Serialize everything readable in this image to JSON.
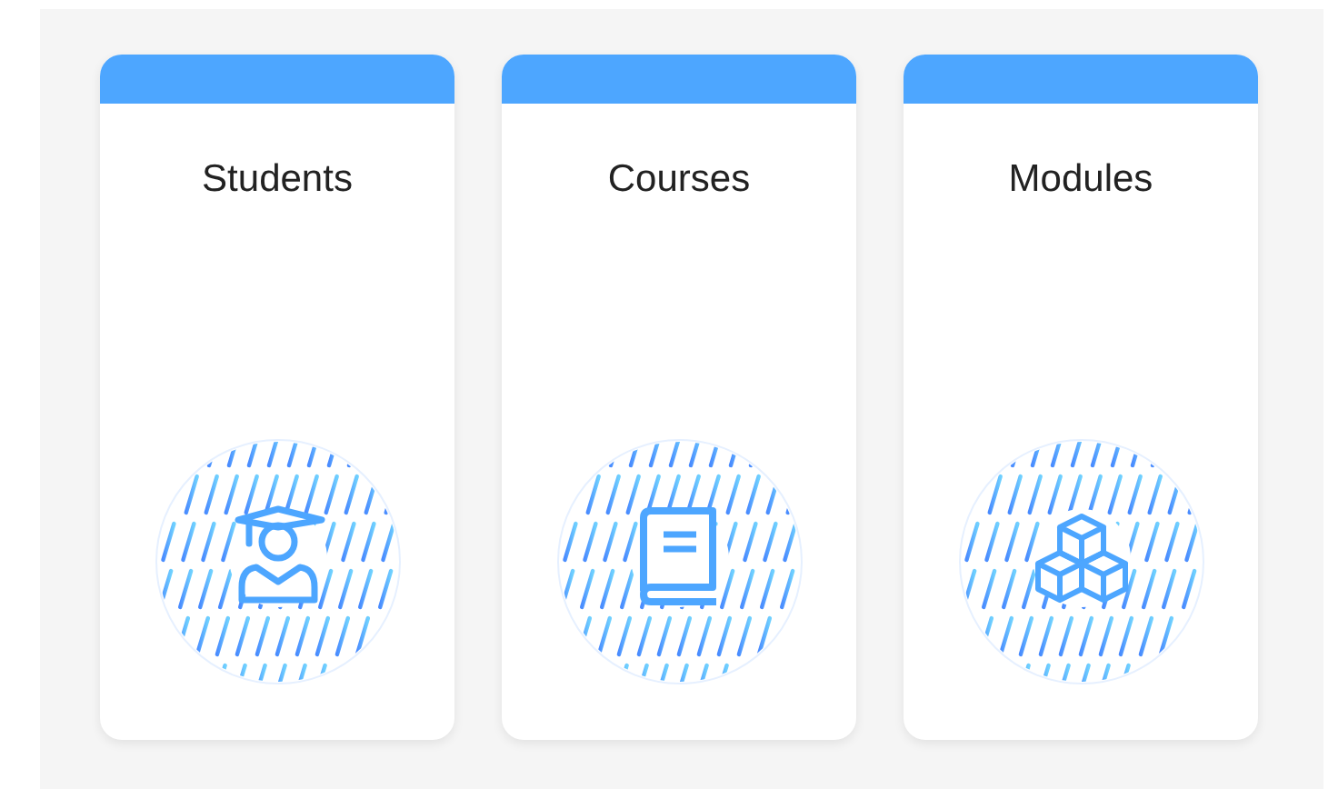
{
  "cards": [
    {
      "title": "Students",
      "kind": "student"
    },
    {
      "title": "Courses",
      "kind": "book"
    },
    {
      "title": "Modules",
      "kind": "cubes"
    }
  ]
}
